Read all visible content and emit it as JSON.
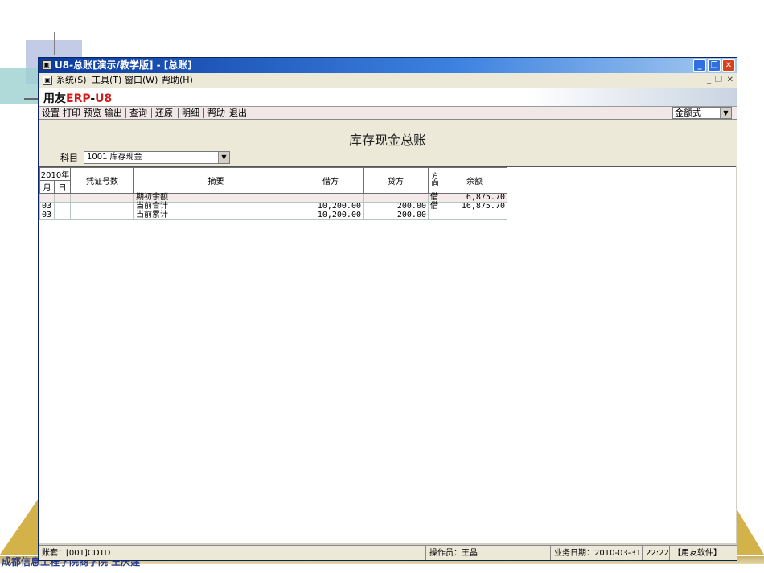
{
  "window": {
    "title": "U8-总账[演示/教学版] - [总账]"
  },
  "menu": {
    "items": [
      "系统(S)",
      "工具(T)",
      "窗口(W)",
      "帮助(H)"
    ]
  },
  "brand": {
    "prefix": "用友",
    "erp": "ERP",
    "dash": "-",
    "u8": "U8"
  },
  "toolbar": {
    "items": [
      "设置",
      "打印",
      "预览",
      "输出",
      "查询",
      "还原",
      "明细",
      "帮助",
      "退出"
    ],
    "format_select": "金额式"
  },
  "report": {
    "title": "库存现金总账",
    "subject_label": "科目",
    "subject_value": "1001 库存现金"
  },
  "table": {
    "year": "2010年",
    "month": "月",
    "day": "日",
    "columns": {
      "voucher": "凭证号数",
      "summary": "摘要",
      "debit": "借方",
      "credit": "贷方",
      "direction": "方向",
      "balance": "余额"
    },
    "rows": [
      {
        "month": "",
        "day": "",
        "voucher": "",
        "summary": "期初余额",
        "debit": "",
        "credit": "",
        "direction": "借",
        "balance": "6,875.70"
      },
      {
        "month": "03",
        "day": "",
        "voucher": "",
        "summary": "当前合计",
        "debit": "10,200.00",
        "credit": "200.00",
        "direction": "借",
        "balance": "16,875.70"
      },
      {
        "month": "03",
        "day": "",
        "voucher": "",
        "summary": "当前累计",
        "debit": "10,200.00",
        "credit": "200.00",
        "direction": "",
        "balance": ""
      }
    ]
  },
  "status": {
    "account": "账套：[001]CDTD",
    "operator": "操作员：王晶",
    "business_date": "业务日期：2010-03-31",
    "time": "22:22",
    "company": "【用友软件】"
  },
  "footer": {
    "text": "成都信息工程学院商学院  王庆建"
  }
}
